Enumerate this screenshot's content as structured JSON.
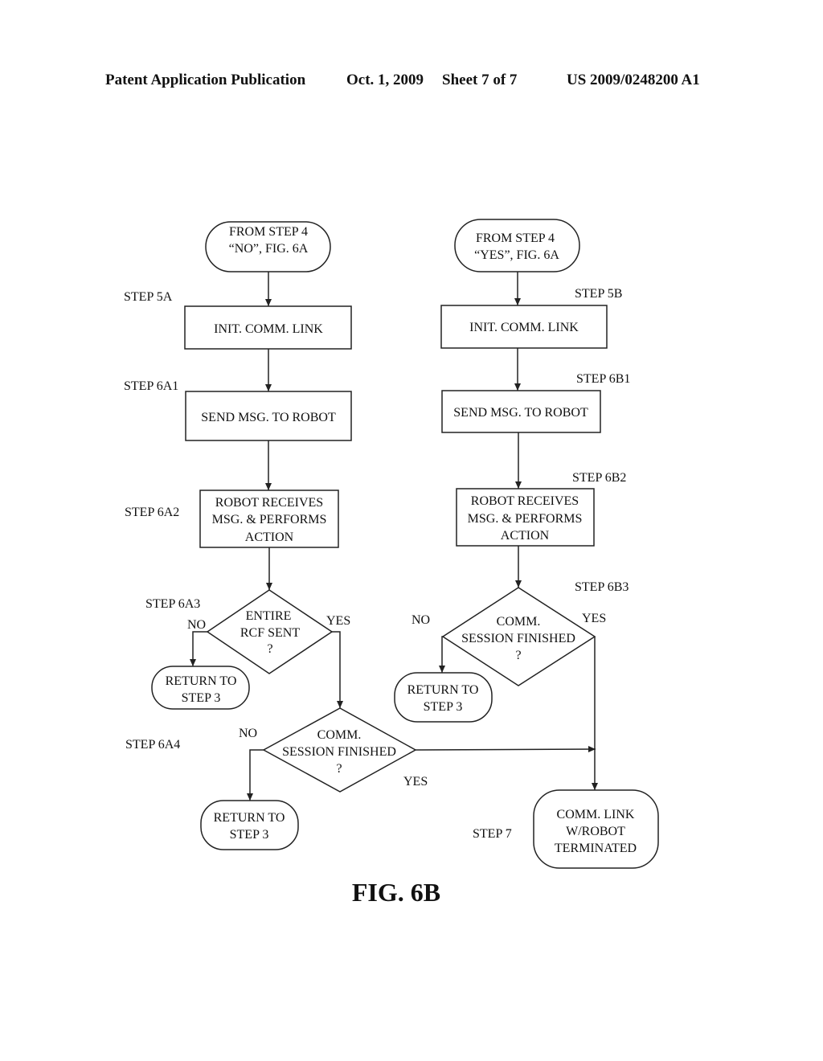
{
  "header": {
    "publication": "Patent Application Publication",
    "date": "Oct. 1, 2009",
    "sheet": "Sheet 7 of 7",
    "number": "US 2009/0248200 A1"
  },
  "figure_label": "FIG. 6B",
  "left_flow": {
    "start": [
      "FROM STEP 4",
      "“NO”, FIG. 6A"
    ],
    "step_5a": {
      "label": "STEP 5A",
      "text": [
        "INIT. COMM. LINK"
      ]
    },
    "step_6a1": {
      "label": "STEP 6A1",
      "text": [
        "SEND MSG. TO ROBOT"
      ]
    },
    "step_6a2": {
      "label": "STEP 6A2",
      "text": [
        "ROBOT RECEIVES",
        "MSG. & PERFORMS",
        "ACTION"
      ]
    },
    "step_6a3": {
      "label": "STEP 6A3",
      "text": [
        "ENTIRE",
        "RCF SENT",
        "?"
      ],
      "no": "NO",
      "yes": "YES"
    },
    "return_a3": [
      "RETURN TO",
      "STEP 3"
    ],
    "step_6a4": {
      "label": "STEP 6A4",
      "text": [
        "COMM.",
        "SESSION FINISHED",
        "?"
      ],
      "no": "NO",
      "yes": "YES"
    },
    "return_a4": [
      "RETURN TO",
      "STEP 3"
    ]
  },
  "right_flow": {
    "start": [
      "FROM STEP 4",
      "“YES”,  FIG. 6A"
    ],
    "step_5b": {
      "label": "STEP 5B",
      "text": [
        "INIT. COMM. LINK"
      ]
    },
    "step_6b1": {
      "label": "STEP 6B1",
      "text": [
        "SEND MSG. TO ROBOT"
      ]
    },
    "step_6b2": {
      "label": "STEP 6B2",
      "text": [
        "ROBOT RECEIVES",
        "MSG. & PERFORMS",
        "ACTION"
      ]
    },
    "step_6b3": {
      "label": "STEP 6B3",
      "text": [
        "COMM.",
        "SESSION FINISHED",
        "?"
      ],
      "no": "NO",
      "yes": "YES"
    },
    "return_b3": [
      "RETURN TO",
      "STEP 3"
    ]
  },
  "step_7": {
    "label": "STEP 7",
    "text": [
      "COMM. LINK",
      "W/ROBOT",
      "TERMINATED"
    ]
  }
}
